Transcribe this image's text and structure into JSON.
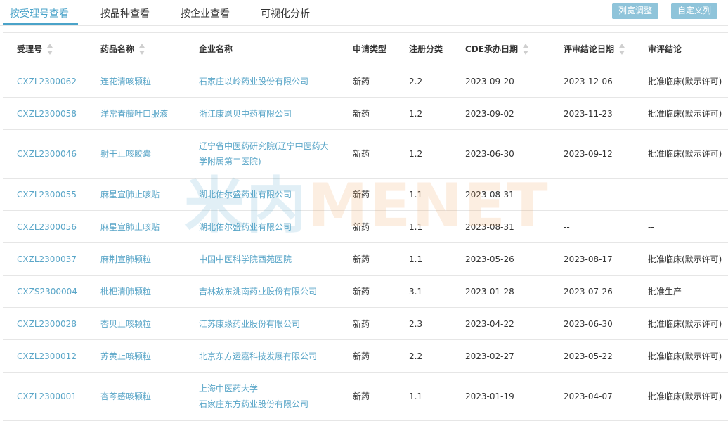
{
  "tabs": [
    {
      "label": "按受理号查看",
      "active": true
    },
    {
      "label": "按品种查看",
      "active": false
    },
    {
      "label": "按企业查看",
      "active": false
    },
    {
      "label": "可视化分析",
      "active": false
    }
  ],
  "buttons": {
    "column_width": "列宽调整",
    "custom_columns": "自定义列"
  },
  "table": {
    "headers": [
      "受理号",
      "药品名称",
      "企业名称",
      "申请类型",
      "注册分类",
      "CDE承办日期",
      "评审结论日期",
      "审评结论"
    ],
    "rows": [
      {
        "id": "CXZL2300062",
        "drug": "连花清咳颗粒",
        "company": [
          "石家庄以岭药业股份有限公司"
        ],
        "type": "新药",
        "cls": "2.2",
        "cde": "2023-09-20",
        "rev": "2023-12-06",
        "result": "批准临床(默示许可)"
      },
      {
        "id": "CXZL2300058",
        "drug": "洋常春藤叶口服液",
        "company": [
          "浙江康恩贝中药有限公司"
        ],
        "type": "新药",
        "cls": "1.2",
        "cde": "2023-09-02",
        "rev": "2023-11-23",
        "result": "批准临床(默示许可)"
      },
      {
        "id": "CXZL2300046",
        "drug": "射干止咳胶囊",
        "company": [
          "辽宁省中医药研究院(辽宁中医药大",
          "学附属第二医院)"
        ],
        "type": "新药",
        "cls": "1.2",
        "cde": "2023-06-30",
        "rev": "2023-09-12",
        "result": "批准临床(默示许可)"
      },
      {
        "id": "CXZL2300055",
        "drug": "麻星宣肺止咳贴",
        "company": [
          "湖北佑尔盛药业有限公司"
        ],
        "type": "新药",
        "cls": "1.1",
        "cde": "2023-08-31",
        "rev": "--",
        "result": "--"
      },
      {
        "id": "CXZL2300056",
        "drug": "麻星宣肺止咳贴",
        "company": [
          "湖北佑尔盛药业有限公司"
        ],
        "type": "新药",
        "cls": "1.1",
        "cde": "2023-08-31",
        "rev": "--",
        "result": "--"
      },
      {
        "id": "CXZL2300037",
        "drug": "麻荆宣肺颗粒",
        "company": [
          "中国中医科学院西苑医院"
        ],
        "type": "新药",
        "cls": "1.1",
        "cde": "2023-05-26",
        "rev": "2023-08-17",
        "result": "批准临床(默示许可)"
      },
      {
        "id": "CXZS2300004",
        "drug": "枇杷清肺颗粒",
        "company": [
          "吉林敖东洮南药业股份有限公司"
        ],
        "type": "新药",
        "cls": "3.1",
        "cde": "2023-01-28",
        "rev": "2023-07-26",
        "result": "批准生产"
      },
      {
        "id": "CXZL2300028",
        "drug": "杏贝止咳颗粒",
        "company": [
          "江苏康缘药业股份有限公司"
        ],
        "type": "新药",
        "cls": "2.3",
        "cde": "2023-04-22",
        "rev": "2023-06-30",
        "result": "批准临床(默示许可)"
      },
      {
        "id": "CXZL2300012",
        "drug": "苏黄止咳颗粒",
        "company": [
          "北京东方运嘉科技发展有限公司"
        ],
        "type": "新药",
        "cls": "2.2",
        "cde": "2023-02-27",
        "rev": "2023-05-22",
        "result": "批准临床(默示许可)"
      },
      {
        "id": "CXZL2300001",
        "drug": "杏芩感咳颗粒",
        "company": [
          "上海中医药大学",
          "石家庄东方药业股份有限公司"
        ],
        "type": "新药",
        "cls": "1.1",
        "cde": "2023-01-19",
        "rev": "2023-04-07",
        "result": "批准临床(默示许可)"
      }
    ]
  },
  "watermark": {
    "cn": "米内",
    "en": "MENET"
  },
  "colors": {
    "accent": "#4aa3c9",
    "link": "#5aa6c8",
    "button": "#8fc4da",
    "watermark_en": "#f29b4b"
  }
}
